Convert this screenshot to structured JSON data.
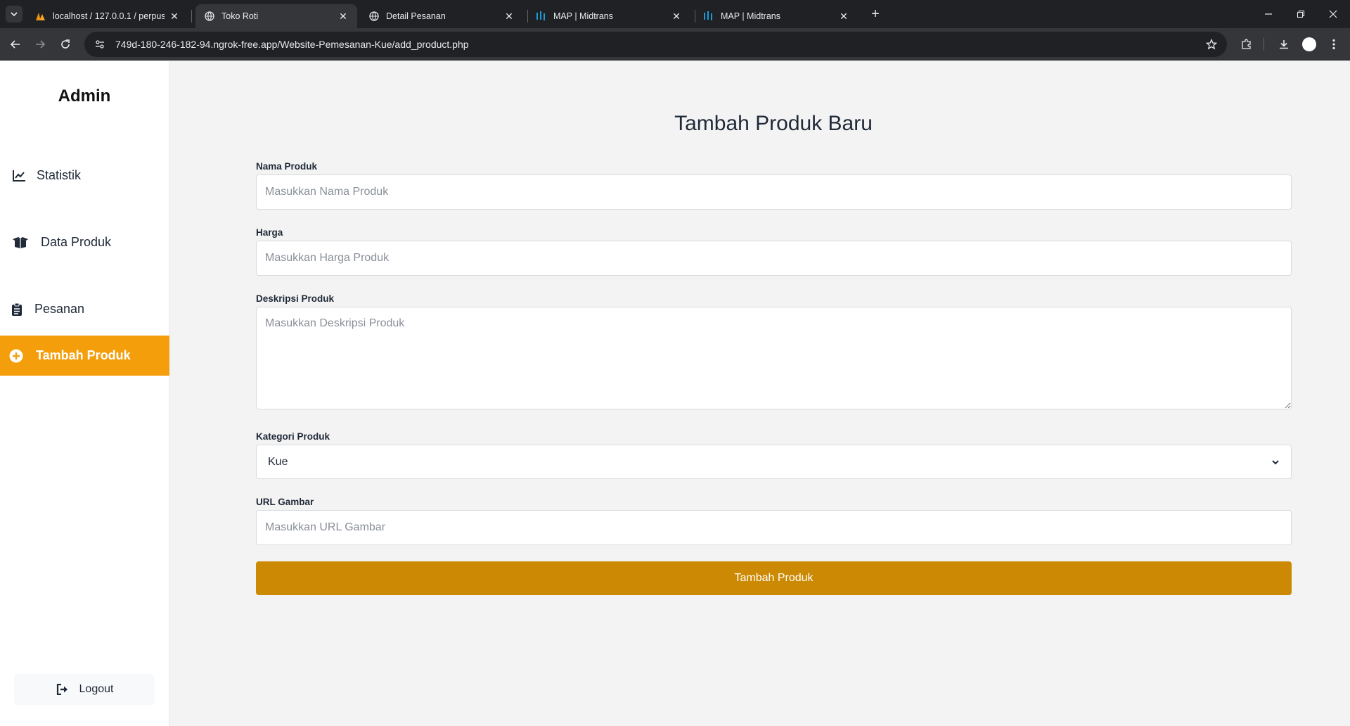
{
  "browser": {
    "tabs": [
      {
        "title": "localhost / 127.0.0.1 / perpustaka",
        "icon": "phpmyadmin-icon",
        "active": false
      },
      {
        "title": "Toko Roti",
        "icon": "globe-icon",
        "active": true
      },
      {
        "title": "Detail Pesanan",
        "icon": "globe-icon",
        "active": false
      },
      {
        "title": "MAP | Midtrans",
        "icon": "midtrans-icon",
        "active": false
      },
      {
        "title": "MAP | Midtrans",
        "icon": "midtrans-icon",
        "active": false
      }
    ],
    "url": "749d-180-246-182-94.ngrok-free.app/Website-Pemesanan-Kue/add_product.php"
  },
  "sidebar": {
    "brand": "Admin",
    "items": [
      {
        "label": "Statistik",
        "icon": "chart-line-icon",
        "active": false
      },
      {
        "label": "Data Produk",
        "icon": "box-open-icon",
        "active": false
      },
      {
        "label": "Pesanan",
        "icon": "clipboard-list-icon",
        "active": false
      },
      {
        "label": "Tambah Produk",
        "icon": "plus-circle-icon",
        "active": true
      }
    ],
    "logout_label": "Logout"
  },
  "form": {
    "title": "Tambah Produk Baru",
    "name": {
      "label": "Nama Produk",
      "placeholder": "Masukkan Nama Produk",
      "value": ""
    },
    "price": {
      "label": "Harga",
      "placeholder": "Masukkan Harga Produk",
      "value": ""
    },
    "description": {
      "label": "Deskripsi Produk",
      "placeholder": "Masukkan Deskripsi Produk",
      "value": ""
    },
    "category": {
      "label": "Kategori Produk",
      "selected": "Kue"
    },
    "image_url": {
      "label": "URL Gambar",
      "placeholder": "Masukkan URL Gambar",
      "value": ""
    },
    "submit_label": "Tambah Produk"
  },
  "colors": {
    "active_nav": "#f59e0b",
    "submit_button": "#cc8a04",
    "browser_dark": "#202124"
  }
}
